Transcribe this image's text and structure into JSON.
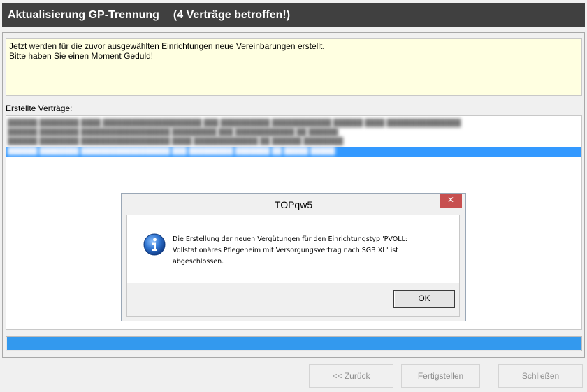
{
  "window": {
    "title": "Aktualisierung GP-Trennung",
    "subtitle": "(4 Verträge betroffen!)"
  },
  "message": {
    "line1": "Jetzt werden für die zuvor ausgewählten Einrichtungen neue Vereinbarungen erstellt.",
    "line2": "Bitte haben Sie einen Moment Geduld!"
  },
  "list": {
    "label": "Erstellte Verträge:"
  },
  "progress": {
    "value": 1.0
  },
  "buttons": {
    "back": "<< Zurück",
    "finish": "Fertigstellen",
    "close": "Schließen"
  },
  "dialog": {
    "title": "TOPqw5",
    "close_symbol": "✕",
    "message_line1": "Die Erstellung der neuen Vergütungen für den Einrichtungstyp 'PVOLL:",
    "message_line2": "Vollstationäres Pflegeheim mit Versorgungsvertrag nach SGB XI ' ist",
    "message_line3": "abgeschlossen.",
    "ok_label": "OK",
    "icon": "info-icon"
  },
  "colors": {
    "header_bg": "#404040",
    "selection": "#3399ff",
    "progress": "#3399ee",
    "message_bg": "#ffffe1",
    "dialog_close": "#c75050"
  }
}
